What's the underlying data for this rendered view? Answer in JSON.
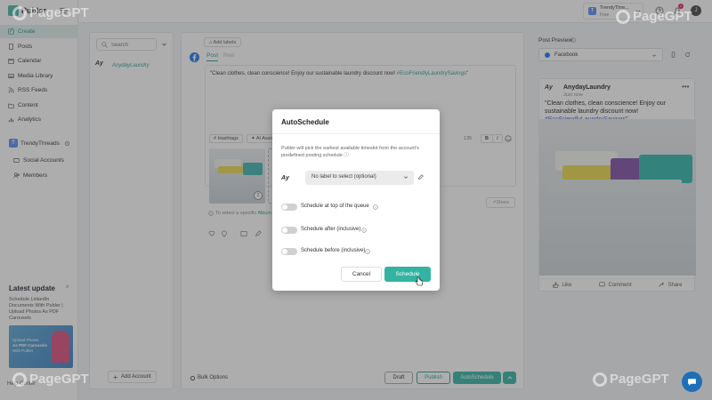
{
  "app": {
    "name": "Publer"
  },
  "sidebar": {
    "nav": [
      {
        "label": "Create",
        "icon": "pencil-square-icon",
        "active": true
      },
      {
        "label": "Posts",
        "icon": "document-icon"
      },
      {
        "label": "Calendar",
        "icon": "calendar-icon"
      },
      {
        "label": "Media Library",
        "icon": "image-icon"
      },
      {
        "label": "RSS Feeds",
        "icon": "rss-icon"
      },
      {
        "label": "Content",
        "icon": "folder-icon"
      },
      {
        "label": "Analytics",
        "icon": "chart-icon"
      }
    ],
    "workspace": {
      "initial": "T",
      "name": "TrendyThreads"
    },
    "workspace_nav": [
      {
        "label": "Social Accounts",
        "icon": "users-icon"
      },
      {
        "label": "Members",
        "icon": "people-icon"
      }
    ],
    "latest_update": {
      "title": "Latest update",
      "text": "Schedule LinkedIn Documents With Publer | Upload Photos As PDF Carousels",
      "image_lines": [
        "Upload Photos",
        "As PDF Carousels",
        "With Publer"
      ]
    },
    "help_center": "Help Center"
  },
  "topbar": {
    "account": {
      "initial": "T",
      "name": "TrendyThre...",
      "plan": "Free"
    },
    "notification_count": "1",
    "user_initial": "J"
  },
  "accounts_panel": {
    "search_placeholder": "Search",
    "account_logo": "Ay",
    "account_name": "AnydayLaundry",
    "add_account": "Add Account"
  },
  "composer": {
    "add_labels": "Add labels",
    "tabs": {
      "post": "Post",
      "reel": "Reel"
    },
    "post_text": "\"Clean clothes, clean conscience! Enjoy our sustainable laundry discount now! ",
    "post_hashtag": "#EcoFriendlyLaundrySavings",
    "post_text_end": "\"",
    "hashtags": "Hashtags",
    "ai_assist": "AI Assist",
    "char_count": "135",
    "bold_label": "B",
    "italic_label": "I",
    "albums_hint_prefix": "To select a specific",
    "albums_hint_link": "Album",
    "thumb_badge": "2",
    "share_label": "Share",
    "bulk_options": "Bulk Options",
    "buttons": {
      "draft": "Draft",
      "publish": "Publish",
      "autoschedule": "AutoSchedule"
    }
  },
  "preview": {
    "title": "Post Preview",
    "network": "Facebook",
    "card": {
      "avatar": "Ay",
      "name": "AnydayLaundry",
      "time": "Just now",
      "text": "\"Clean clothes, clean conscience! Enjoy our sustainable laundry discount now! ",
      "hashtag": "#EcoFriendlyLaundrySavings",
      "text_end": "\"",
      "actions": {
        "like": "Like",
        "comment": "Comment",
        "share": "Share"
      }
    }
  },
  "modal": {
    "title": "AutoSchedule",
    "description": "Publer will pick the earliest available timeslot from the account's predefined posting schedule",
    "logo": "Ay",
    "label_select": "No label to select (optional)",
    "toggles": [
      {
        "label": "Schedule at top of the queue"
      },
      {
        "label": "Schedule after (inclusive)"
      },
      {
        "label": "Schedule before (inclusive)"
      }
    ],
    "cancel": "Cancel",
    "schedule": "Schedule"
  },
  "watermark": "PageGPT",
  "colors": {
    "accent": "#33b3a2",
    "hashtag": "#2a9d8f",
    "facebook": "#1877f2"
  }
}
